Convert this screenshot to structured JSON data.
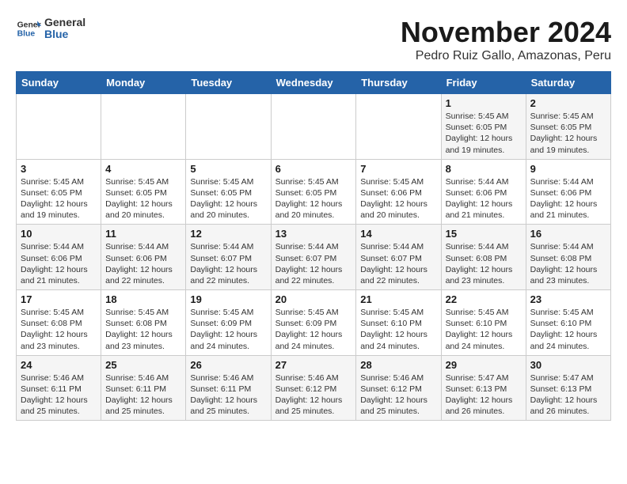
{
  "header": {
    "logo_line1": "General",
    "logo_line2": "Blue",
    "month_year": "November 2024",
    "location": "Pedro Ruiz Gallo, Amazonas, Peru"
  },
  "weekdays": [
    "Sunday",
    "Monday",
    "Tuesday",
    "Wednesday",
    "Thursday",
    "Friday",
    "Saturday"
  ],
  "weeks": [
    [
      {
        "day": "",
        "sunrise": "",
        "sunset": "",
        "daylight": ""
      },
      {
        "day": "",
        "sunrise": "",
        "sunset": "",
        "daylight": ""
      },
      {
        "day": "",
        "sunrise": "",
        "sunset": "",
        "daylight": ""
      },
      {
        "day": "",
        "sunrise": "",
        "sunset": "",
        "daylight": ""
      },
      {
        "day": "",
        "sunrise": "",
        "sunset": "",
        "daylight": ""
      },
      {
        "day": "1",
        "sunrise": "Sunrise: 5:45 AM",
        "sunset": "Sunset: 6:05 PM",
        "daylight": "Daylight: 12 hours and 19 minutes."
      },
      {
        "day": "2",
        "sunrise": "Sunrise: 5:45 AM",
        "sunset": "Sunset: 6:05 PM",
        "daylight": "Daylight: 12 hours and 19 minutes."
      }
    ],
    [
      {
        "day": "3",
        "sunrise": "Sunrise: 5:45 AM",
        "sunset": "Sunset: 6:05 PM",
        "daylight": "Daylight: 12 hours and 19 minutes."
      },
      {
        "day": "4",
        "sunrise": "Sunrise: 5:45 AM",
        "sunset": "Sunset: 6:05 PM",
        "daylight": "Daylight: 12 hours and 20 minutes."
      },
      {
        "day": "5",
        "sunrise": "Sunrise: 5:45 AM",
        "sunset": "Sunset: 6:05 PM",
        "daylight": "Daylight: 12 hours and 20 minutes."
      },
      {
        "day": "6",
        "sunrise": "Sunrise: 5:45 AM",
        "sunset": "Sunset: 6:05 PM",
        "daylight": "Daylight: 12 hours and 20 minutes."
      },
      {
        "day": "7",
        "sunrise": "Sunrise: 5:45 AM",
        "sunset": "Sunset: 6:06 PM",
        "daylight": "Daylight: 12 hours and 20 minutes."
      },
      {
        "day": "8",
        "sunrise": "Sunrise: 5:44 AM",
        "sunset": "Sunset: 6:06 PM",
        "daylight": "Daylight: 12 hours and 21 minutes."
      },
      {
        "day": "9",
        "sunrise": "Sunrise: 5:44 AM",
        "sunset": "Sunset: 6:06 PM",
        "daylight": "Daylight: 12 hours and 21 minutes."
      }
    ],
    [
      {
        "day": "10",
        "sunrise": "Sunrise: 5:44 AM",
        "sunset": "Sunset: 6:06 PM",
        "daylight": "Daylight: 12 hours and 21 minutes."
      },
      {
        "day": "11",
        "sunrise": "Sunrise: 5:44 AM",
        "sunset": "Sunset: 6:06 PM",
        "daylight": "Daylight: 12 hours and 22 minutes."
      },
      {
        "day": "12",
        "sunrise": "Sunrise: 5:44 AM",
        "sunset": "Sunset: 6:07 PM",
        "daylight": "Daylight: 12 hours and 22 minutes."
      },
      {
        "day": "13",
        "sunrise": "Sunrise: 5:44 AM",
        "sunset": "Sunset: 6:07 PM",
        "daylight": "Daylight: 12 hours and 22 minutes."
      },
      {
        "day": "14",
        "sunrise": "Sunrise: 5:44 AM",
        "sunset": "Sunset: 6:07 PM",
        "daylight": "Daylight: 12 hours and 22 minutes."
      },
      {
        "day": "15",
        "sunrise": "Sunrise: 5:44 AM",
        "sunset": "Sunset: 6:08 PM",
        "daylight": "Daylight: 12 hours and 23 minutes."
      },
      {
        "day": "16",
        "sunrise": "Sunrise: 5:44 AM",
        "sunset": "Sunset: 6:08 PM",
        "daylight": "Daylight: 12 hours and 23 minutes."
      }
    ],
    [
      {
        "day": "17",
        "sunrise": "Sunrise: 5:45 AM",
        "sunset": "Sunset: 6:08 PM",
        "daylight": "Daylight: 12 hours and 23 minutes."
      },
      {
        "day": "18",
        "sunrise": "Sunrise: 5:45 AM",
        "sunset": "Sunset: 6:08 PM",
        "daylight": "Daylight: 12 hours and 23 minutes."
      },
      {
        "day": "19",
        "sunrise": "Sunrise: 5:45 AM",
        "sunset": "Sunset: 6:09 PM",
        "daylight": "Daylight: 12 hours and 24 minutes."
      },
      {
        "day": "20",
        "sunrise": "Sunrise: 5:45 AM",
        "sunset": "Sunset: 6:09 PM",
        "daylight": "Daylight: 12 hours and 24 minutes."
      },
      {
        "day": "21",
        "sunrise": "Sunrise: 5:45 AM",
        "sunset": "Sunset: 6:10 PM",
        "daylight": "Daylight: 12 hours and 24 minutes."
      },
      {
        "day": "22",
        "sunrise": "Sunrise: 5:45 AM",
        "sunset": "Sunset: 6:10 PM",
        "daylight": "Daylight: 12 hours and 24 minutes."
      },
      {
        "day": "23",
        "sunrise": "Sunrise: 5:45 AM",
        "sunset": "Sunset: 6:10 PM",
        "daylight": "Daylight: 12 hours and 24 minutes."
      }
    ],
    [
      {
        "day": "24",
        "sunrise": "Sunrise: 5:46 AM",
        "sunset": "Sunset: 6:11 PM",
        "daylight": "Daylight: 12 hours and 25 minutes."
      },
      {
        "day": "25",
        "sunrise": "Sunrise: 5:46 AM",
        "sunset": "Sunset: 6:11 PM",
        "daylight": "Daylight: 12 hours and 25 minutes."
      },
      {
        "day": "26",
        "sunrise": "Sunrise: 5:46 AM",
        "sunset": "Sunset: 6:11 PM",
        "daylight": "Daylight: 12 hours and 25 minutes."
      },
      {
        "day": "27",
        "sunrise": "Sunrise: 5:46 AM",
        "sunset": "Sunset: 6:12 PM",
        "daylight": "Daylight: 12 hours and 25 minutes."
      },
      {
        "day": "28",
        "sunrise": "Sunrise: 5:46 AM",
        "sunset": "Sunset: 6:12 PM",
        "daylight": "Daylight: 12 hours and 25 minutes."
      },
      {
        "day": "29",
        "sunrise": "Sunrise: 5:47 AM",
        "sunset": "Sunset: 6:13 PM",
        "daylight": "Daylight: 12 hours and 26 minutes."
      },
      {
        "day": "30",
        "sunrise": "Sunrise: 5:47 AM",
        "sunset": "Sunset: 6:13 PM",
        "daylight": "Daylight: 12 hours and 26 minutes."
      }
    ]
  ]
}
